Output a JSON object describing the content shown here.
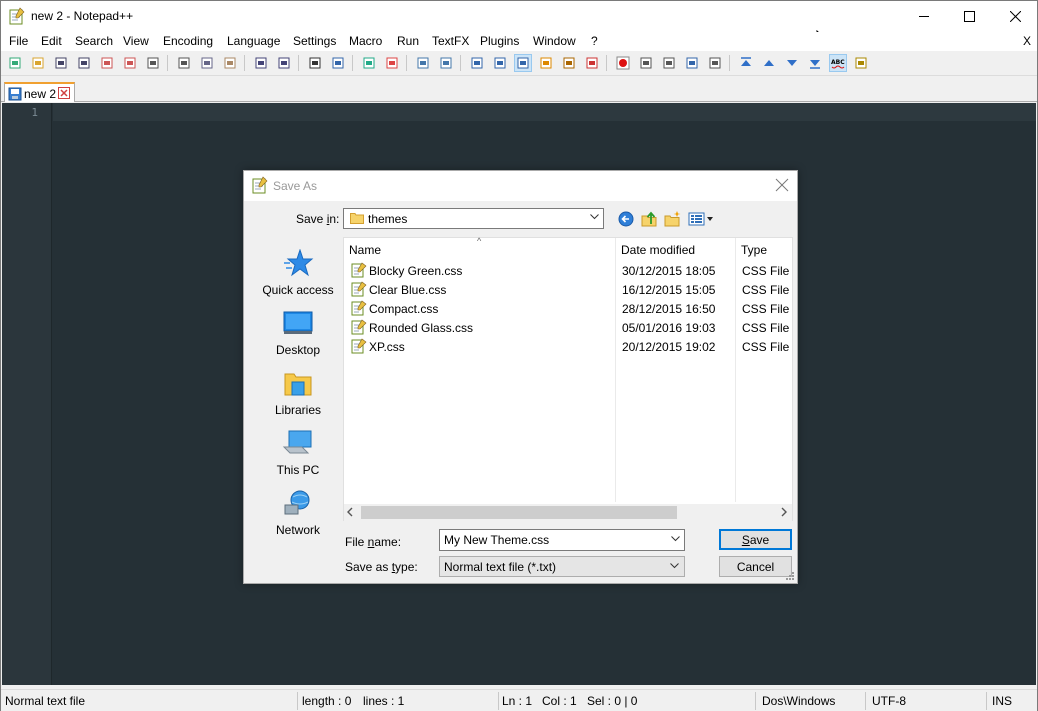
{
  "window": {
    "title": "new 2 - Notepad++"
  },
  "menu": {
    "items": [
      "File",
      "Edit",
      "Search",
      "View",
      "Encoding",
      "Language",
      "Settings",
      "Macro",
      "Run",
      "TextFX",
      "Plugins",
      "Window",
      "?"
    ],
    "close_label": "X"
  },
  "toolbar": {
    "icons": [
      "new-file-icon",
      "open-file-icon",
      "save-icon",
      "save-all-icon",
      "close-icon",
      "close-all-icon",
      "print-icon",
      "cut-icon",
      "copy-icon",
      "paste-icon",
      "undo-icon",
      "redo-icon",
      "find-icon",
      "replace-icon",
      "zoom-in-icon",
      "zoom-out-icon",
      "sync-vertical-icon",
      "sync-horizontal-icon",
      "word-wrap-icon",
      "show-all-chars-icon",
      "indent-guide-icon",
      "user-defined-lang-icon",
      "doc-map-icon",
      "function-list-icon",
      "record-macro-icon",
      "stop-record-icon",
      "play-macro-icon",
      "run-macro-multiple-icon",
      "save-macro-icon",
      "nav-top-icon",
      "nav-up-icon",
      "nav-down-icon",
      "nav-bottom-icon",
      "spellcheck-icon",
      "compare-icon"
    ],
    "spellcheck_label": "ABC"
  },
  "tabs": [
    {
      "label": "new 2"
    }
  ],
  "editor": {
    "line_numbers": [
      "1"
    ]
  },
  "status": {
    "file_type": "Normal text file",
    "length": "length : 0",
    "lines": "lines : 1",
    "ln": "Ln : 1",
    "col": "Col : 1",
    "sel": "Sel : 0 | 0",
    "eol": "Dos\\Windows",
    "encoding": "UTF-8",
    "mode": "INS"
  },
  "dialog": {
    "title": "Save As",
    "save_in": {
      "label_pre": "Save ",
      "label_ul": "i",
      "label_post": "n:",
      "value": "themes"
    },
    "places": [
      {
        "label": "Quick access",
        "icon": "star-icon"
      },
      {
        "label": "Desktop",
        "icon": "desktop-icon"
      },
      {
        "label": "Libraries",
        "icon": "libraries-icon"
      },
      {
        "label": "This PC",
        "icon": "computer-icon"
      },
      {
        "label": "Network",
        "icon": "network-icon"
      }
    ],
    "columns": {
      "name": "Name",
      "date": "Date modified",
      "type": "Type"
    },
    "files": [
      {
        "name": "Blocky Green.css",
        "date": "30/12/2015 18:05",
        "type": "CSS File"
      },
      {
        "name": "Clear Blue.css",
        "date": "16/12/2015 15:05",
        "type": "CSS File"
      },
      {
        "name": "Compact.css",
        "date": "28/12/2015 16:50",
        "type": "CSS File"
      },
      {
        "name": "Rounded Glass.css",
        "date": "05/01/2016 19:03",
        "type": "CSS File"
      },
      {
        "name": "XP.css",
        "date": "20/12/2015 19:02",
        "type": "CSS File"
      }
    ],
    "file_name": {
      "label_pre": "File ",
      "label_ul": "n",
      "label_post": "ame:",
      "value": "My New Theme.css"
    },
    "save_as_type": {
      "label_pre": "Save as ",
      "label_ul": "t",
      "label_post": "ype:",
      "value": "Normal text file (*.txt)"
    },
    "save_button": {
      "ul": "S",
      "rest": "ave"
    },
    "cancel_button": "Cancel"
  }
}
